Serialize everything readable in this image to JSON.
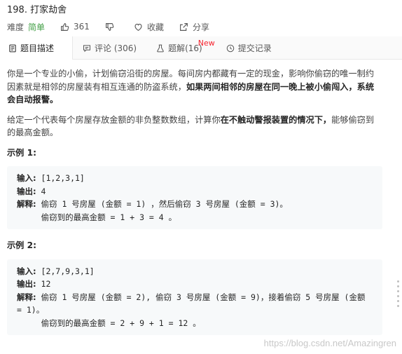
{
  "problem": {
    "title": "198. 打家劫舍",
    "difficulty_label": "难度",
    "difficulty_value": "简单",
    "likes": "361",
    "favorite_label": "收藏",
    "share_label": "分享"
  },
  "tabs": [
    {
      "label": "题目描述",
      "icon": "file-text-icon"
    },
    {
      "label": "评论 (306)",
      "icon": "comment-icon"
    },
    {
      "label": "题解(16)",
      "icon": "flask-icon",
      "badge": "New"
    },
    {
      "label": "提交记录",
      "icon": "clock-icon"
    }
  ],
  "description": {
    "p1_a": "你是一个专业的小偷，计划偷窃沿街的房屋。每间房内都藏有一定的现金，影响你偷窃的唯一制约因素就是相邻的房屋装有相互连通的防盗系统，",
    "p1_b": "如果两间相邻的房屋在同一晚上被小偷闯入，系统会自动报警。",
    "p2_a": "给定一个代表每个房屋存放金额的非负整数数组，计算你",
    "p2_b": "在不触动警报装置的情况下，",
    "p2_c": "能够偷窃到的最高金额。"
  },
  "examples": [
    {
      "title": "示例 1:",
      "input_label": "输入:",
      "input": " [1,2,3,1]",
      "output_label": "输出:",
      "output": " 4",
      "explain_label": "解释:",
      "explain": " 偷窃 1 号房屋 (金额 = 1) ，然后偷窃 3 号房屋 (金额 = 3)。",
      "explain2": "     偷窃到的最高金额 = 1 + 3 = 4 。"
    },
    {
      "title": "示例 2:",
      "input_label": "输入:",
      "input": " [2,7,9,3,1]",
      "output_label": "输出:",
      "output": " 12",
      "explain_label": "解释:",
      "explain": " 偷窃 1 号房屋 (金额 = 2), 偷窃 3 号房屋 (金额 = 9)，接着偷窃 5 号房屋 (金额 = 1)。",
      "explain2": "     偷窃到的最高金额 = 2 + 9 + 1 = 12 。"
    }
  ],
  "watermark": "https://blog.csdn.net/Amazingren",
  "colors": {
    "easy": "#43a047",
    "new_badge": "#f5222d"
  }
}
